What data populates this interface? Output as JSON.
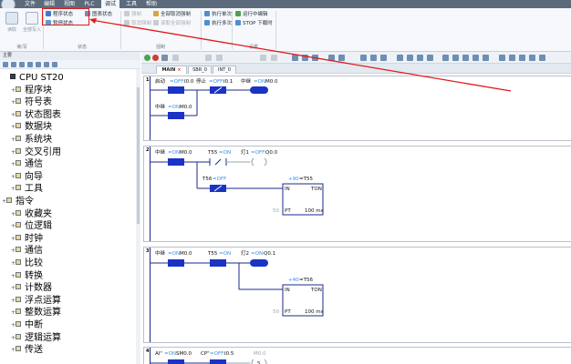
{
  "menu": [
    "文件",
    "编辑",
    "视图",
    "PLC",
    "调试",
    "工具",
    "帮助"
  ],
  "ribbon": {
    "big_buttons": [
      "读取",
      "全部写入"
    ],
    "group_labels": [
      "读/写",
      "状态",
      "强制",
      "设置"
    ],
    "status": {
      "program_status": "程序状态",
      "chart_status": "图表状态",
      "pause_status": "暂停状态"
    },
    "force": {
      "force": "强制",
      "cancel_force": "取消强制",
      "cancel_all_force": "全部取消强制",
      "read_all_force": "读取全部强制"
    },
    "exec": {
      "single": "执行单次",
      "multi": "执行多次"
    },
    "run": {
      "run_edit": "运行中编辑",
      "stop_download": "STOP 下载时"
    }
  },
  "tree": {
    "panel_title": "主要",
    "items": [
      {
        "label": "CPU ST20",
        "kind": "root"
      },
      {
        "label": "程序块"
      },
      {
        "label": "符号表"
      },
      {
        "label": "状态图表"
      },
      {
        "label": "数据块"
      },
      {
        "label": "系统块"
      },
      {
        "label": "交叉引用"
      },
      {
        "label": "通信"
      },
      {
        "label": "向导"
      },
      {
        "label": "工具"
      },
      {
        "label": "指令",
        "kind": "root2"
      },
      {
        "label": "收藏夹"
      },
      {
        "label": "位逻辑"
      },
      {
        "label": "时钟"
      },
      {
        "label": "通信"
      },
      {
        "label": "比较"
      },
      {
        "label": "转换"
      },
      {
        "label": "计数器"
      },
      {
        "label": "浮点运算"
      },
      {
        "label": "整数运算"
      },
      {
        "label": "中断"
      },
      {
        "label": "逻辑运算"
      },
      {
        "label": "传送"
      }
    ]
  },
  "editor": {
    "tabs": [
      "MAIN",
      "SBR_0",
      "INT_0"
    ],
    "networks": [
      {
        "num": "1",
        "labels": [
          "启动",
          "=OFF:",
          "I0.0",
          "停止",
          "=OFF:",
          "I0.1",
          "中继",
          "=ON:",
          "M0.0",
          "中继",
          "=ON:",
          "M0.0"
        ]
      },
      {
        "num": "2",
        "labels": [
          "中继",
          "=ON:",
          "M0.0",
          "T55",
          "=ON",
          "灯1",
          "=OFF:",
          "Q0.0",
          "T56",
          "=OFF",
          "+90",
          "=T55",
          "IN",
          "TON",
          "50",
          "PT",
          "100 ms"
        ]
      },
      {
        "num": "3",
        "labels": [
          "中继",
          "=ON:",
          "M0.0",
          "T55",
          "=ON",
          "灯2",
          "=ON:",
          "Q0.1",
          "+40",
          "=T56",
          "IN",
          "TON",
          "50",
          "PT",
          "100 ms"
        ]
      },
      {
        "num": "4",
        "labels": [
          "AI\"",
          "=ON:",
          "SM0.0",
          "CP\"",
          "=OFF:",
          "I0.5",
          "M0.0",
          "S"
        ]
      }
    ]
  },
  "colors": {
    "active_contact": "#1a33c4",
    "wire": "#1b2a8c",
    "state_text": "#3a8ee6",
    "highlight_box": "#e3191c"
  }
}
